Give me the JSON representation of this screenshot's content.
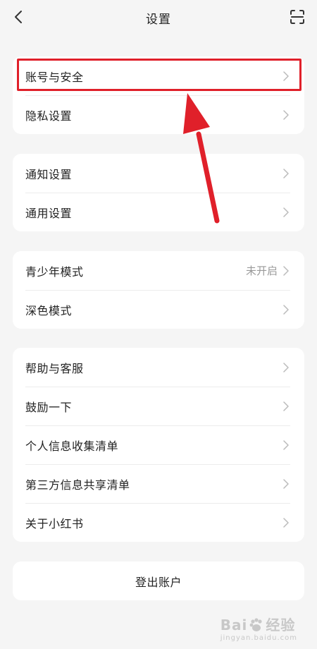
{
  "header": {
    "title": "设置"
  },
  "groups": {
    "g1": [
      {
        "label": "账号与安全"
      },
      {
        "label": "隐私设置"
      }
    ],
    "g2": [
      {
        "label": "通知设置"
      },
      {
        "label": "通用设置"
      }
    ],
    "g3": [
      {
        "label": "青少年模式",
        "value": "未开启"
      },
      {
        "label": "深色模式"
      }
    ],
    "g4": [
      {
        "label": "帮助与客服"
      },
      {
        "label": "鼓励一下"
      },
      {
        "label": "个人信息收集清单"
      },
      {
        "label": "第三方信息共享清单"
      },
      {
        "label": "关于小红书"
      }
    ]
  },
  "logout": {
    "label": "登出账户"
  },
  "annotation": {
    "color": "#e0202a"
  },
  "watermark": {
    "text_left": "Bai",
    "text_right": "经验",
    "sub": "jingyan.baidu.com"
  }
}
